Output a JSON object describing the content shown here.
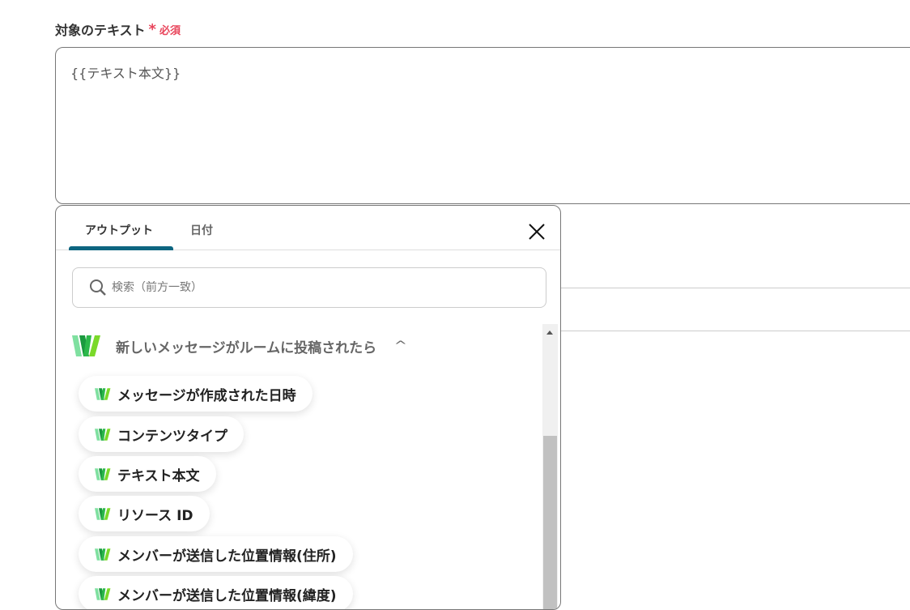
{
  "field": {
    "label": "対象のテキスト",
    "required_mark": "*",
    "required_label": "必須",
    "value": "{{テキスト本文}}"
  },
  "popup": {
    "tabs": [
      {
        "label": "アウトプット",
        "active": true
      },
      {
        "label": "日付",
        "active": false
      }
    ],
    "search_placeholder": "検索（前方一致）",
    "group": {
      "title": "新しいメッセージがルームに投稿されたら",
      "icon": "w-app-icon",
      "expanded": true
    },
    "items": [
      {
        "label": "メッセージが作成された日時"
      },
      {
        "label": "コンテンツタイプ"
      },
      {
        "label": "テキスト本文"
      },
      {
        "label": "リソース ID"
      },
      {
        "label": "メンバーが送信した位置情報(住所)"
      },
      {
        "label": "メンバーが送信した位置情報(緯度)"
      }
    ]
  },
  "colors": {
    "accent": "#0d6580",
    "required": "#e8445a"
  }
}
